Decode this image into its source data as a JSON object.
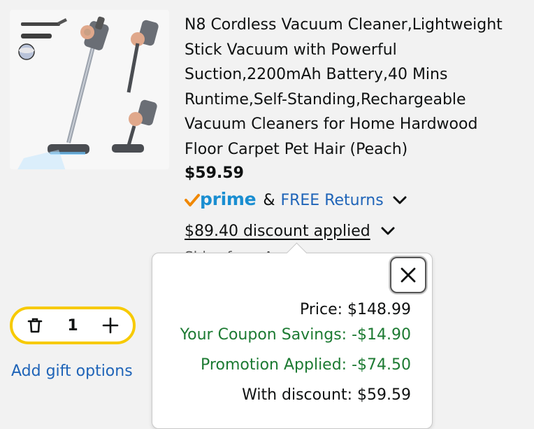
{
  "product": {
    "title": "N8 Cordless Vacuum Cleaner,Lightweight Stick Vacuum with Powerful Suction,2200mAh Battery,40 Mins Runtime,Self-Standing,Rechargeable Vacuum Cleaners for Home Hardwood Floor Carpet Pet Hair (Peach)",
    "price": "$59.59",
    "image_icon": "vacuum-product-image"
  },
  "shipping": {
    "prime_label": "prime",
    "amp": "&",
    "free_returns": "FREE Returns"
  },
  "discount": {
    "applied_label": "$89.40 discount applied",
    "ships_from_partial": "Ships from Amazon"
  },
  "cart": {
    "quantity": "1",
    "gift_options": "Add gift options"
  },
  "popover": {
    "price_line": "Price: $148.99",
    "coupon_line": "Your Coupon Savings: -$14.90",
    "promo_line": "Promotion Applied: -$74.50",
    "final_line": "With discount: $59.59"
  },
  "colors": {
    "prime_blue": "#1a8ed1",
    "link_blue": "#1f64b8",
    "savings_green": "#1c7a32",
    "stepper_yellow": "#f7ca00",
    "prime_check_orange": "#f08804"
  }
}
